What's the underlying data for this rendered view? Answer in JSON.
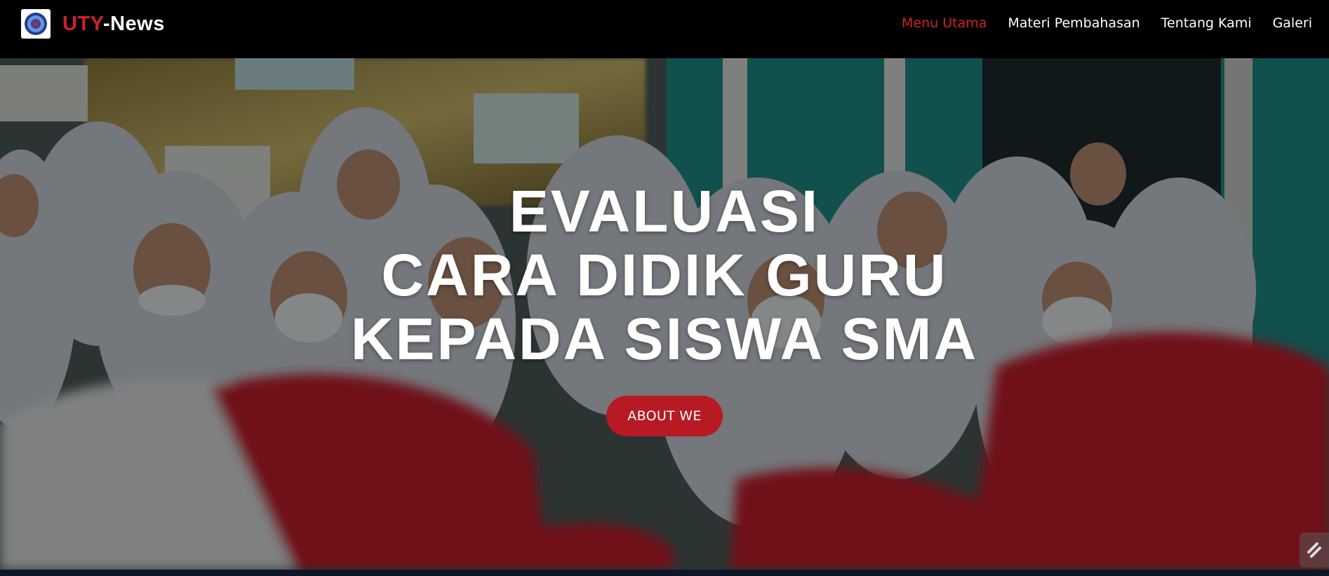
{
  "brand": {
    "name_accent": "UTY",
    "name_rest": "-News",
    "logo_icon": "university-seal-icon"
  },
  "nav": {
    "items": [
      {
        "label": "Menu Utama",
        "active": true
      },
      {
        "label": "Materi Pembahasan",
        "active": false
      },
      {
        "label": "Tentang Kami",
        "active": false
      },
      {
        "label": "Galeri",
        "active": false
      }
    ]
  },
  "hero": {
    "title_lines": [
      "EVALUASI",
      "CARA DIDIK GURU",
      "KEPADA SISWA SMA"
    ],
    "button_label": "ABOUT WE",
    "background_description_icon": "students-photo"
  },
  "colors": {
    "accent": "#d0202a",
    "button": "#b71a22",
    "navbar": "#000000",
    "footer_strip": "#0d1626"
  }
}
